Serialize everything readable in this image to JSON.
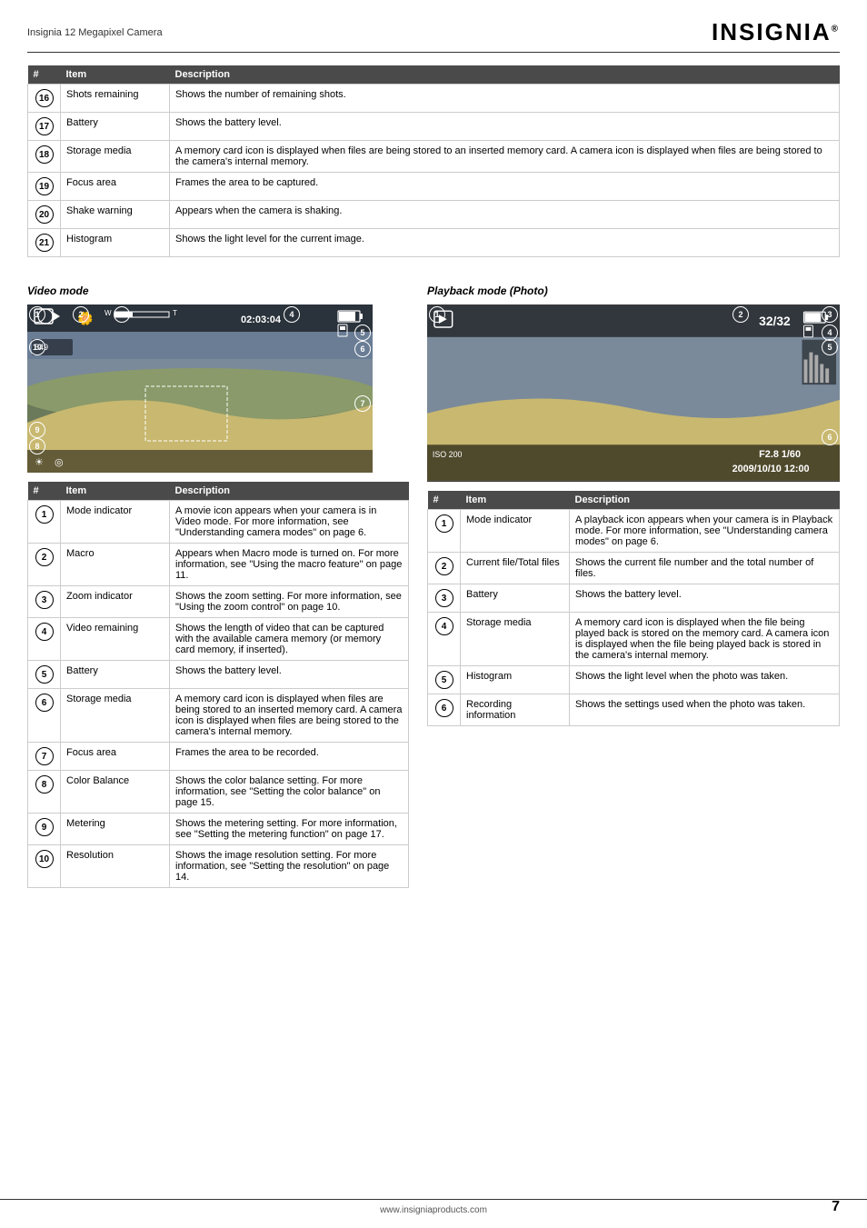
{
  "header": {
    "title": "Insignia 12 Megapixel Camera",
    "logo": "INSIGNIA",
    "tm": "®"
  },
  "footer": {
    "url": "www.insigniaproducts.com",
    "page": "7"
  },
  "top_table": {
    "headers": [
      "#",
      "Item",
      "Description"
    ],
    "rows": [
      {
        "num": "16",
        "item": "Shots remaining",
        "desc": "Shows the number of remaining shots."
      },
      {
        "num": "17",
        "item": "Battery",
        "desc": "Shows the battery level."
      },
      {
        "num": "18",
        "item": "Storage media",
        "desc": "A memory card icon is displayed when files are being stored to an inserted memory card. A camera icon is displayed when files are being stored to the camera's internal memory."
      },
      {
        "num": "19",
        "item": "Focus area",
        "desc": "Frames the area to be captured."
      },
      {
        "num": "20",
        "item": "Shake warning",
        "desc": "Appears when the camera is shaking."
      },
      {
        "num": "21",
        "item": "Histogram",
        "desc": "Shows the light level for the current image."
      }
    ]
  },
  "video_mode": {
    "heading": "Video mode",
    "table": {
      "headers": [
        "#",
        "Item",
        "Description"
      ],
      "rows": [
        {
          "num": "1",
          "item": "Mode indicator",
          "desc": "A movie icon appears when your camera is in Video mode. For more information, see \"Understanding camera modes\" on page 6."
        },
        {
          "num": "2",
          "item": "Macro",
          "desc": "Appears when Macro mode is turned on. For more information, see \"Using the macro feature\" on page 11."
        },
        {
          "num": "3",
          "item": "Zoom indicator",
          "desc": "Shows the zoom setting. For more information, see \"Using the zoom control\" on page 10."
        },
        {
          "num": "4",
          "item": "Video remaining",
          "desc": "Shows the length of video that can be captured with the available camera memory (or memory card memory, if inserted)."
        },
        {
          "num": "5",
          "item": "Battery",
          "desc": "Shows the battery level."
        },
        {
          "num": "6",
          "item": "Storage media",
          "desc": "A memory card icon is displayed when files are being stored to an inserted memory card. A camera icon is displayed when files are being stored to the camera's internal memory."
        },
        {
          "num": "7",
          "item": "Focus area",
          "desc": "Frames the area to be recorded."
        },
        {
          "num": "8",
          "item": "Color Balance",
          "desc": "Shows the color balance setting. For more information, see \"Setting the color balance\" on page 15."
        },
        {
          "num": "9",
          "item": "Metering",
          "desc": "Shows the metering setting. For more information, see \"Setting the metering function\" on page 17."
        },
        {
          "num": "10",
          "item": "Resolution",
          "desc": "Shows the image resolution setting. For more information, see \"Setting the resolution\" on page 14."
        }
      ]
    }
  },
  "playback_mode": {
    "heading": "Playback mode (Photo)",
    "table": {
      "headers": [
        "#",
        "Item",
        "Description"
      ],
      "rows": [
        {
          "num": "1",
          "item": "Mode indicator",
          "desc": "A playback icon appears when your camera is in Playback mode. For more information, see \"Understanding camera modes\" on page 6."
        },
        {
          "num": "2",
          "item": "Current file/Total files",
          "desc": "Shows the current file number and the total number of files."
        },
        {
          "num": "3",
          "item": "Battery",
          "desc": "Shows the battery level."
        },
        {
          "num": "4",
          "item": "Storage media",
          "desc": "A memory card icon is displayed when the file being played back is stored on the memory card. A camera icon is displayed when the file being played back is stored in the camera's internal memory."
        },
        {
          "num": "5",
          "item": "Histogram",
          "desc": "Shows the light level when the photo was taken."
        },
        {
          "num": "6",
          "item": "Recording information",
          "desc": "Shows the settings used when the photo was taken."
        }
      ]
    }
  }
}
